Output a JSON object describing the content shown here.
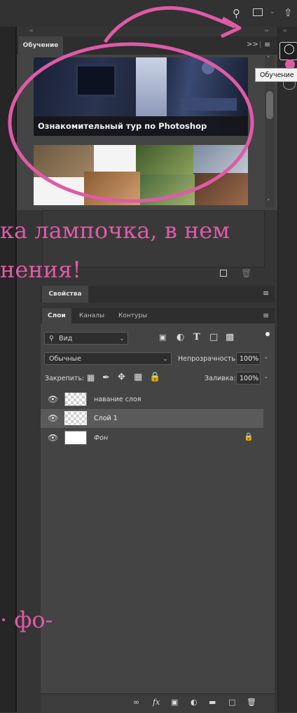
{
  "learn_panel": {
    "tab_label": "Обучение",
    "card1_caption": "Ознакомительный тур по Photoshop"
  },
  "tooltip": "Обучение",
  "properties": {
    "tab_label": "Свойства"
  },
  "layers": {
    "tabs": [
      "Слои",
      "Каналы",
      "Контуры"
    ],
    "filter_label": "Вид",
    "blend_mode": "Обычные",
    "opacity_label": "Непрозрачность:",
    "opacity_value": "100%",
    "lock_label": "Закрепить:",
    "fill_label": "Заливка:",
    "fill_value": "100%",
    "rows": [
      {
        "name": "навание слоя"
      },
      {
        "name": "Слой 1"
      },
      {
        "name": "Фон"
      }
    ]
  },
  "overlay_text": {
    "line1": "ка лампочка, в нем",
    "line2": "нения!",
    "line3": "· фо-"
  },
  "accent_color": "#e05aa8"
}
